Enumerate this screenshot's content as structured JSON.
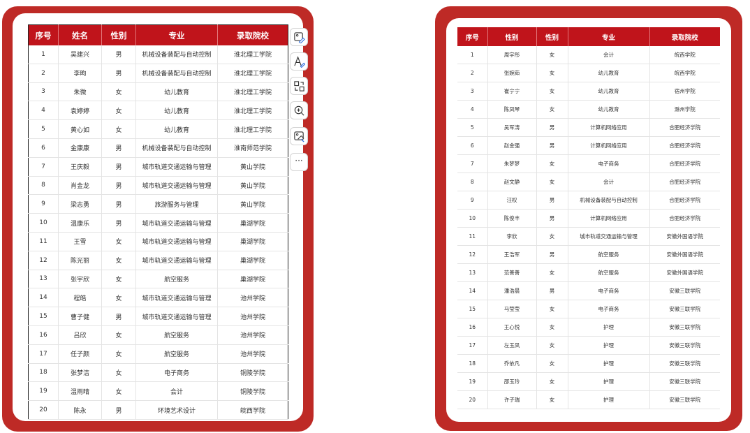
{
  "left_table": {
    "headers": [
      "序号",
      "姓名",
      "性别",
      "专业",
      "录取院校"
    ],
    "rows": [
      [
        "1",
        "吴建兴",
        "男",
        "机械设备装配与自动控制",
        "淮北理工学院"
      ],
      [
        "2",
        "李昫",
        "男",
        "机械设备装配与自动控制",
        "淮北理工学院"
      ],
      [
        "3",
        "朱微",
        "女",
        "幼儿教育",
        "淮北理工学院"
      ],
      [
        "4",
        "袁婷婷",
        "女",
        "幼儿教育",
        "淮北理工学院"
      ],
      [
        "5",
        "黄心如",
        "女",
        "幼儿教育",
        "淮北理工学院"
      ],
      [
        "6",
        "金康康",
        "男",
        "机械设备装配与自动控制",
        "淮南师范学院"
      ],
      [
        "7",
        "王庆毅",
        "男",
        "城市轨道交通运输与管理",
        "黄山学院"
      ],
      [
        "8",
        "肖金龙",
        "男",
        "城市轨道交通运输与管理",
        "黄山学院"
      ],
      [
        "9",
        "梁志勇",
        "男",
        "旅游服务与管理",
        "黄山学院"
      ],
      [
        "10",
        "温康乐",
        "男",
        "城市轨道交通运输与管理",
        "巢湖学院"
      ],
      [
        "11",
        "王雪",
        "女",
        "城市轨道交通运输与管理",
        "巢湖学院"
      ],
      [
        "12",
        "陈光丽",
        "女",
        "城市轨道交通运输与管理",
        "巢湖学院"
      ],
      [
        "13",
        "张宇欣",
        "女",
        "航空服务",
        "巢湖学院"
      ],
      [
        "14",
        "程皓",
        "女",
        "城市轨道交通运输与管理",
        "池州学院"
      ],
      [
        "15",
        "曹子健",
        "男",
        "城市轨道交通运输与管理",
        "池州学院"
      ],
      [
        "16",
        "吕欣",
        "女",
        "航空服务",
        "池州学院"
      ],
      [
        "17",
        "任子颜",
        "女",
        "航空服务",
        "池州学院"
      ],
      [
        "18",
        "张梦洁",
        "女",
        "电子商务",
        "铜陵学院"
      ],
      [
        "19",
        "温雨晴",
        "女",
        "会计",
        "铜陵学院"
      ],
      [
        "20",
        "陈永",
        "男",
        "环境艺术设计",
        "皖西学院"
      ]
    ]
  },
  "right_table": {
    "headers": [
      "序号",
      "性别",
      "性别",
      "专业",
      "录取院校"
    ],
    "rows": [
      [
        "1",
        "周宇彤",
        "女",
        "会计",
        "皖西学院"
      ],
      [
        "2",
        "张婉茹",
        "女",
        "幼儿教育",
        "皖西学院"
      ],
      [
        "3",
        "崔宁宁",
        "女",
        "幼儿教育",
        "宿州学院"
      ],
      [
        "4",
        "陈凤琴",
        "女",
        "幼儿教育",
        "滁州学院"
      ],
      [
        "5",
        "吴军涛",
        "男",
        "计算机网络应用",
        "合肥经济学院"
      ],
      [
        "6",
        "赵金强",
        "男",
        "计算机网络应用",
        "合肥经济学院"
      ],
      [
        "7",
        "朱梦梦",
        "女",
        "电子商务",
        "合肥经济学院"
      ],
      [
        "8",
        "赵文静",
        "女",
        "会计",
        "合肥经济学院"
      ],
      [
        "9",
        "汪权",
        "男",
        "机械设备装配与自动控制",
        "合肥经济学院"
      ],
      [
        "10",
        "陈俊丰",
        "男",
        "计算机网络应用",
        "合肥经济学院"
      ],
      [
        "11",
        "李欣",
        "女",
        "城市轨道交通运输与管理",
        "安徽外国语学院"
      ],
      [
        "12",
        "王浩军",
        "男",
        "航空服务",
        "安徽外国语学院"
      ],
      [
        "13",
        "范善善",
        "女",
        "航空服务",
        "安徽外国语学院"
      ],
      [
        "14",
        "潘浩晨",
        "男",
        "电子商务",
        "安徽三联学院"
      ],
      [
        "15",
        "马莹莹",
        "女",
        "电子商务",
        "安徽三联学院"
      ],
      [
        "16",
        "王心悦",
        "女",
        "护理",
        "安徽三联学院"
      ],
      [
        "17",
        "左玉凤",
        "女",
        "护理",
        "安徽三联学院"
      ],
      [
        "18",
        "乔依凡",
        "女",
        "护理",
        "安徽三联学院"
      ],
      [
        "19",
        "邵玉玲",
        "女",
        "护理",
        "安徽三联学院"
      ],
      [
        "20",
        "许子瑞",
        "女",
        "护理",
        "安徽三联学院"
      ]
    ]
  },
  "toolbar": {
    "items": [
      {
        "icon": "image-edit-icon"
      },
      {
        "icon": "text-highlight-icon"
      },
      {
        "icon": "image-translate-icon"
      },
      {
        "icon": "zoom-in-icon"
      },
      {
        "icon": "ai-edit-icon"
      },
      {
        "icon": "more-options-icon",
        "label": "···"
      }
    ]
  },
  "colors": {
    "card_frame": "#be2a26",
    "header_bg": "#c0141b",
    "header_text": "#ffffff",
    "cell_text": "#333333",
    "grid_line": "#e4e4e4"
  }
}
